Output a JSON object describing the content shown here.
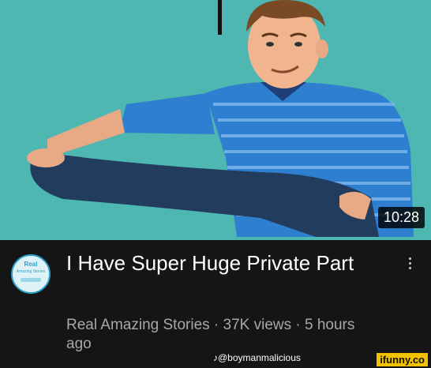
{
  "video": {
    "duration": "10:28",
    "title": "I Have Super Huge Private Part",
    "meta": "Real Amazing Stories · 37K views · 5 hours ago",
    "channel_avatar": {
      "line1": "Real",
      "line2": "Amazing Stories"
    }
  },
  "watermarks": {
    "tiktok": "♪@boymanmalicious",
    "ifunny": "ifunny.co"
  },
  "colors": {
    "thumbnail_bg": "#4fb7b1",
    "shirt": "#2f7fd0",
    "pants": "#223c5e",
    "info_bg": "#151515"
  }
}
